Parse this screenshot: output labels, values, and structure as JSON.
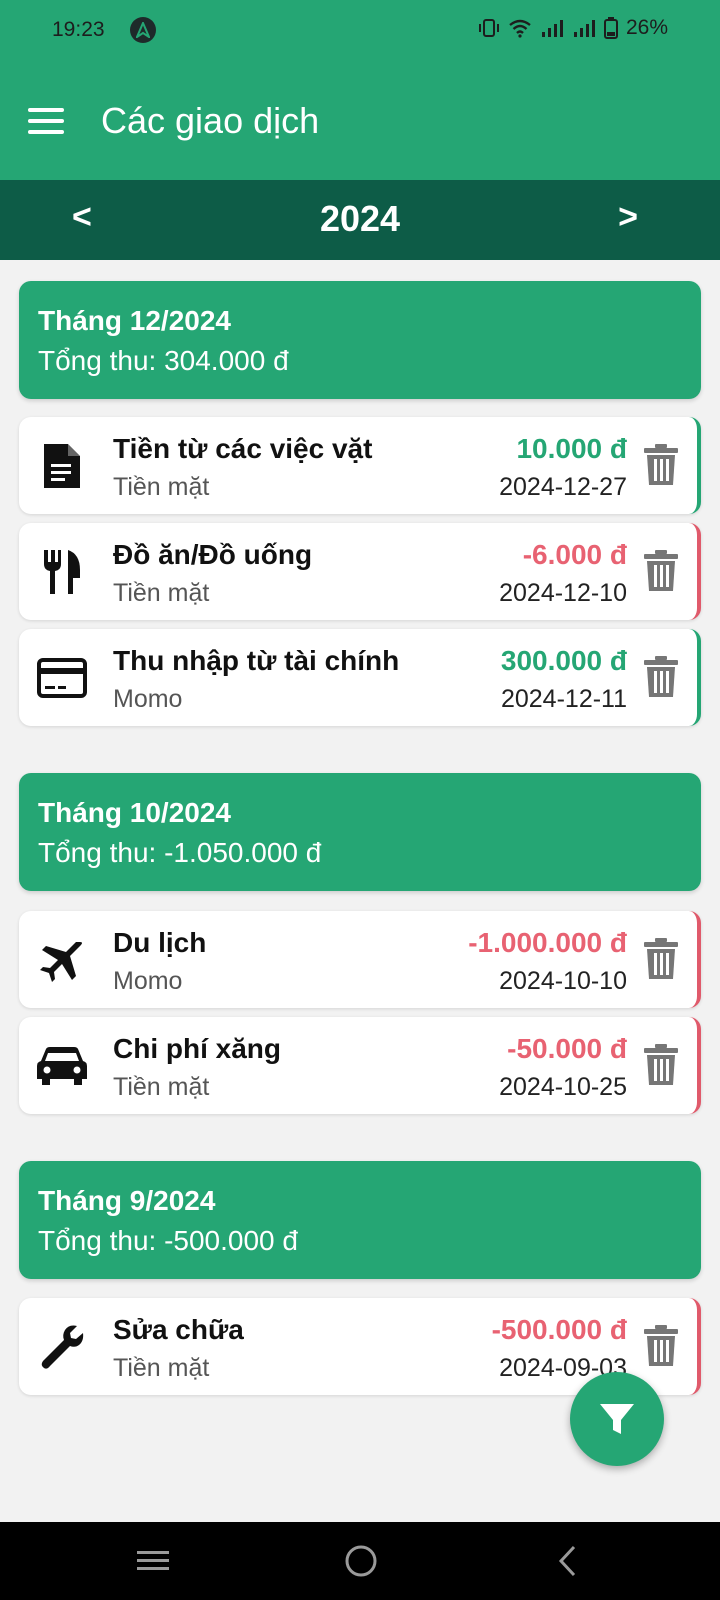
{
  "status_bar": {
    "time": "19:23",
    "battery": "26%"
  },
  "app_bar": {
    "title": "Các giao dịch"
  },
  "year_selector": {
    "prev": "<",
    "year": "2024",
    "next": ">"
  },
  "months": [
    {
      "title": "Tháng 12/2024",
      "total": "Tổng thu: 304.000 đ",
      "transactions": [
        {
          "name": "Tiền từ các việc vặt",
          "account": "Tiền mặt",
          "amount": "10.000 đ",
          "date": "2024-12-27",
          "type": "income",
          "icon": "document-icon"
        },
        {
          "name": "Đồ ăn/Đồ uống",
          "account": "Tiền mặt",
          "amount": "-6.000 đ",
          "date": "2024-12-10",
          "type": "expense",
          "icon": "fork-knife-icon"
        },
        {
          "name": "Thu nhập từ tài chính",
          "account": "Momo",
          "amount": "300.000 đ",
          "date": "2024-12-11",
          "type": "income",
          "icon": "credit-card-icon"
        }
      ]
    },
    {
      "title": "Tháng 10/2024",
      "total": "Tổng thu: -1.050.000 đ",
      "transactions": [
        {
          "name": "Du lịch",
          "account": "Momo",
          "amount": "-1.000.000 đ",
          "date": "2024-10-10",
          "type": "expense",
          "icon": "airplane-icon"
        },
        {
          "name": "Chi phí xăng",
          "account": "Tiền mặt",
          "amount": "-50.000 đ",
          "date": "2024-10-25",
          "type": "expense",
          "icon": "car-icon"
        }
      ]
    },
    {
      "title": "Tháng 9/2024",
      "total": "Tổng thu: -500.000 đ",
      "transactions": [
        {
          "name": "Sửa chữa",
          "account": "Tiền mặt",
          "amount": "-500.000 đ",
          "date": "2024-09-03",
          "type": "expense",
          "icon": "wrench-icon"
        }
      ]
    }
  ],
  "colors": {
    "primary": "#25a674",
    "dark": "#0d5c47",
    "income": "#25a674",
    "expense": "#e86272"
  }
}
